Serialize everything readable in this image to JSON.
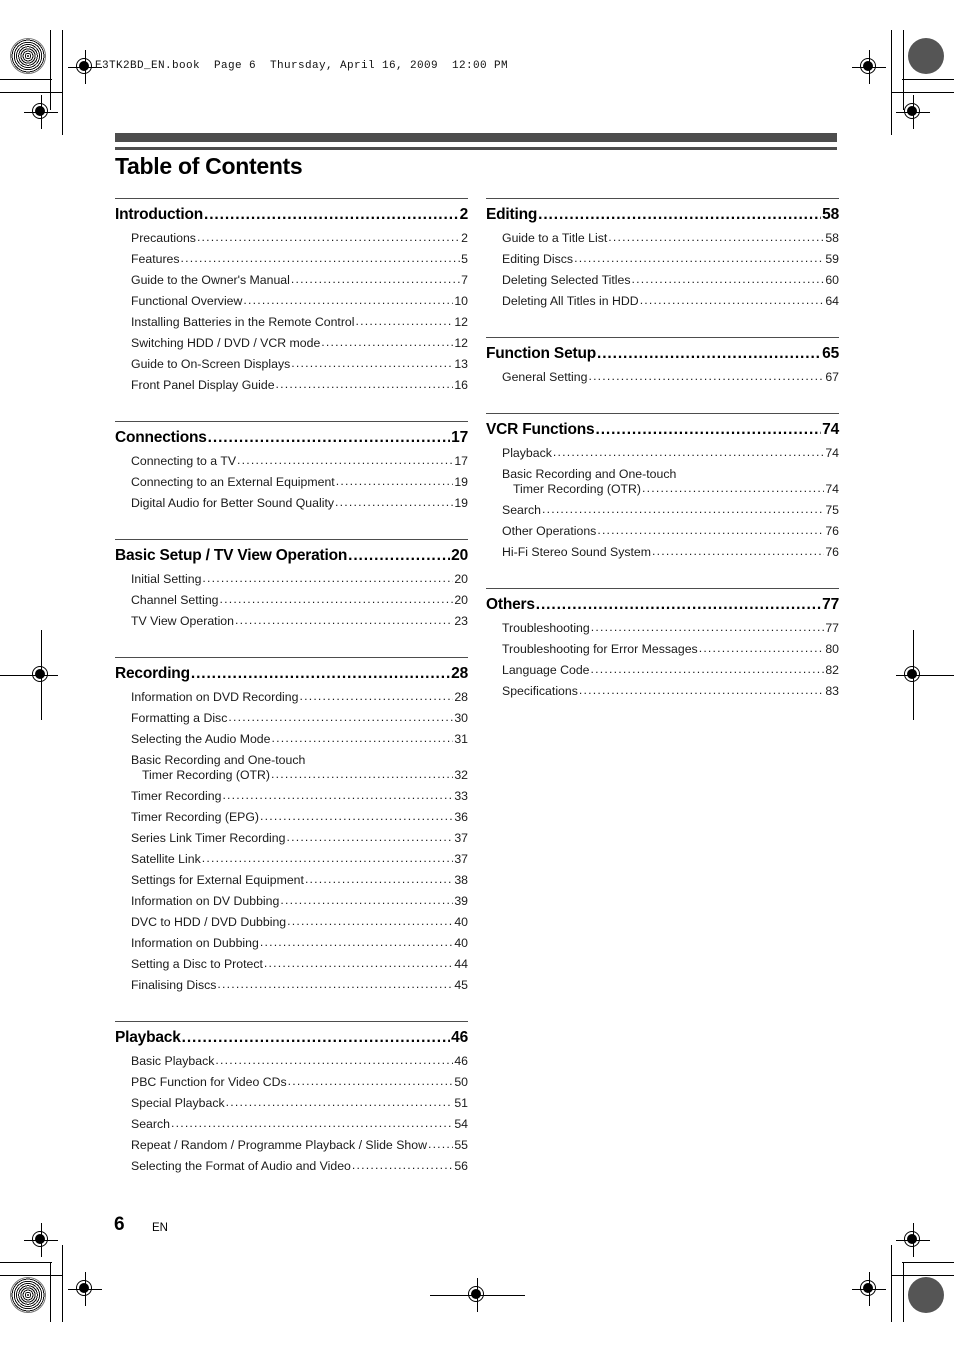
{
  "header": {
    "book_line": "E3TK2BD_EN.book  Page 6  Thursday, April 16, 2009  12:00 PM"
  },
  "page_title": "Table of Contents",
  "footer": {
    "page_number": "6",
    "language": "EN"
  },
  "colors": {
    "rule": "#4d4d4d",
    "text": "#000000"
  },
  "columns": [
    {
      "name": "left",
      "sections": [
        {
          "heading": "Introduction",
          "page": "2",
          "entries": [
            {
              "label": "Precautions",
              "page": "2"
            },
            {
              "label": "Features",
              "page": "5"
            },
            {
              "label": "Guide to the Owner's Manual",
              "page": "7"
            },
            {
              "label": "Functional Overview",
              "page": "10"
            },
            {
              "label": "Installing Batteries in the Remote Control",
              "page": "12"
            },
            {
              "label": "Switching HDD / DVD / VCR mode",
              "page": "12"
            },
            {
              "label": "Guide to On-Screen Displays",
              "page": "13"
            },
            {
              "label": "Front Panel Display Guide",
              "page": "16"
            }
          ]
        },
        {
          "heading": "Connections",
          "page": "17",
          "entries": [
            {
              "label": "Connecting to a TV",
              "page": "17"
            },
            {
              "label": "Connecting to an External Equipment",
              "page": "19"
            },
            {
              "label": "Digital Audio for Better Sound Quality",
              "page": "19"
            }
          ]
        },
        {
          "heading": "Basic Setup / TV View Operation",
          "page": "20",
          "entries": [
            {
              "label": "Initial Setting",
              "page": "20"
            },
            {
              "label": "Channel Setting",
              "page": "20"
            },
            {
              "label": "TV View Operation",
              "page": "23"
            }
          ]
        },
        {
          "heading": "Recording",
          "page": "28",
          "entries": [
            {
              "label": "Information on DVD Recording",
              "page": "28"
            },
            {
              "label": "Formatting a Disc",
              "page": "30"
            },
            {
              "label": "Selecting the Audio Mode",
              "page": "31"
            },
            {
              "first_line": "Basic Recording and One-touch",
              "label": "Timer Recording (OTR)",
              "page": "32"
            },
            {
              "label": "Timer Recording",
              "page": "33"
            },
            {
              "label": "Timer Recording (EPG)",
              "page": "36"
            },
            {
              "label": "Series Link Timer Recording",
              "page": "37"
            },
            {
              "label": "Satellite Link",
              "page": "37"
            },
            {
              "label": "Settings for External Equipment",
              "page": "38"
            },
            {
              "label": "Information on DV Dubbing",
              "page": "39"
            },
            {
              "label": "DVC to HDD / DVD Dubbing",
              "page": "40"
            },
            {
              "label": "Information on Dubbing",
              "page": "40"
            },
            {
              "label": "Setting a Disc to Protect",
              "page": "44"
            },
            {
              "label": "Finalising Discs",
              "page": "45"
            }
          ]
        },
        {
          "heading": "Playback",
          "page": "46",
          "entries": [
            {
              "label": "Basic Playback",
              "page": "46"
            },
            {
              "label": "PBC Function for Video CDs",
              "page": "50"
            },
            {
              "label": "Special Playback",
              "page": "51"
            },
            {
              "label": "Search",
              "page": "54"
            },
            {
              "label": "Repeat / Random / Programme Playback / Slide Show",
              "page": "55"
            },
            {
              "label": "Selecting the Format of Audio and Video",
              "page": "56"
            }
          ]
        }
      ]
    },
    {
      "name": "right",
      "sections": [
        {
          "heading": "Editing",
          "page": "58",
          "entries": [
            {
              "label": "Guide to a Title List",
              "page": "58"
            },
            {
              "label": "Editing Discs",
              "page": "59"
            },
            {
              "label": "Deleting Selected Titles",
              "page": "60"
            },
            {
              "label": "Deleting All Titles in HDD",
              "page": "64"
            }
          ]
        },
        {
          "heading": "Function Setup",
          "page": "65",
          "entries": [
            {
              "label": "General Setting",
              "page": "67"
            }
          ]
        },
        {
          "heading": "VCR Functions",
          "page": "74",
          "entries": [
            {
              "label": "Playback",
              "page": "74"
            },
            {
              "first_line": "Basic Recording and One-touch",
              "label": "Timer Recording (OTR)",
              "page": "74"
            },
            {
              "label": "Search",
              "page": "75"
            },
            {
              "label": "Other Operations",
              "page": "76"
            },
            {
              "label": "Hi-Fi Stereo Sound System",
              "page": "76"
            }
          ]
        },
        {
          "heading": "Others",
          "page": "77",
          "entries": [
            {
              "label": "Troubleshooting",
              "page": "77"
            },
            {
              "label": "Troubleshooting for Error Messages",
              "page": "80"
            },
            {
              "label": "Language Code",
              "page": "82"
            },
            {
              "label": "Specifications",
              "page": "83"
            }
          ]
        }
      ]
    }
  ]
}
